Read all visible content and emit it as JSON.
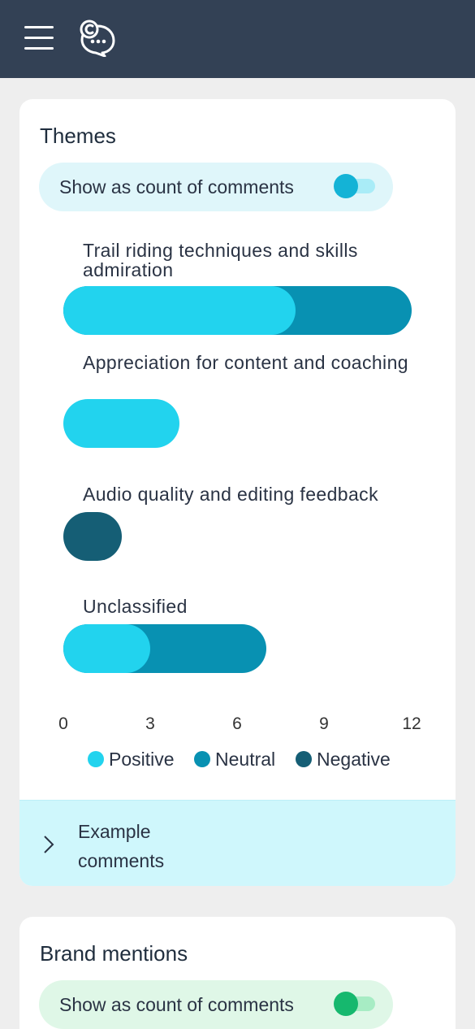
{
  "header": {
    "menu_icon": "hamburger-menu-icon",
    "logo_icon": "chat-bubble-logo-icon",
    "colors": {
      "background": "#334155",
      "foreground": "#ffffff"
    }
  },
  "themes_card": {
    "title": "Themes",
    "toggle": {
      "label": "Show as count of comments",
      "on": true
    },
    "expand": {
      "label_line1": "Example",
      "label_line2": "comments",
      "icon": "chevron-right-icon"
    }
  },
  "brand_card": {
    "title": "Brand mentions",
    "toggle": {
      "label": "Show as count of comments",
      "on": true
    }
  },
  "chart_data": {
    "type": "bar",
    "orientation": "horizontal",
    "stacked": true,
    "categories": [
      "Trail riding techniques and skills admiration",
      "Appreciation for content and coaching",
      "Audio quality and editing feedback",
      "Unclassified"
    ],
    "series": [
      {
        "name": "Positive",
        "color": "#22d3ee",
        "values": [
          8,
          4,
          0,
          3
        ]
      },
      {
        "name": "Neutral",
        "color": "#0891b2",
        "values": [
          4,
          0,
          0,
          4
        ]
      },
      {
        "name": "Negative",
        "color": "#155e75",
        "values": [
          0,
          0,
          2,
          0
        ]
      }
    ],
    "xlim": [
      0,
      12
    ],
    "xticks": [
      "0",
      "3",
      "6",
      "9",
      "12"
    ],
    "legend_placement": "bottom"
  }
}
